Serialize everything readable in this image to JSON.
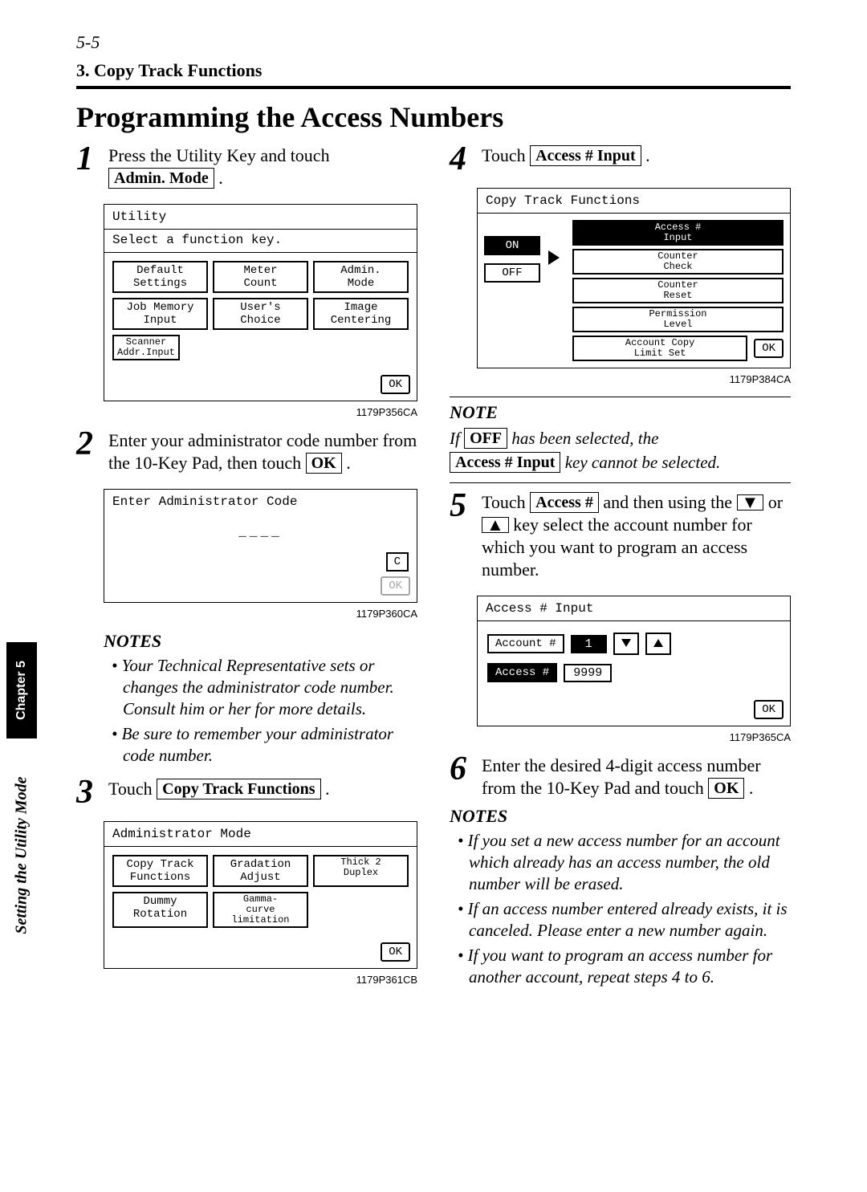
{
  "page_number_label": "5-5",
  "section_header": "3. Copy Track Functions",
  "heading": "Programming the Access Numbers",
  "side_tab_black": "Chapter 5",
  "side_tab_italic": "Setting the Utility Mode",
  "step1": {
    "num": "1",
    "text_before": "Press the Utility Key and touch ",
    "btn": "Admin. Mode",
    "text_after": " ."
  },
  "panel1": {
    "title": "Utility",
    "subtitle": "Select a function key.",
    "buttons_row1": [
      "Default\nSettings",
      "Meter\nCount",
      "Admin.\nMode"
    ],
    "buttons_row2_c0": "Job Memory\nInput",
    "buttons_row2_c1": "User's\nChoice",
    "buttons_row2_c2": "Image\nCentering",
    "buttons_row3": "Scanner\nAddr.Input",
    "ok": "OK",
    "caption": "1179P356CA"
  },
  "step2": {
    "num": "2",
    "text": "Enter your administrator code number from the 10-Key Pad, then touch ",
    "btn": "OK",
    "after": " ."
  },
  "panel2": {
    "title": "Enter Administrator Code",
    "dashes": "____",
    "clear": "C",
    "ok": "OK",
    "caption": "1179P360CA"
  },
  "notes_left": {
    "heading": "NOTES",
    "items": [
      "Your Technical Representative sets or changes the administrator code number. Consult him or her for more details.",
      "Be sure to remember your administrator code number."
    ]
  },
  "step3": {
    "num": "3",
    "text": "Touch ",
    "btn": "Copy Track Functions",
    "after": " ."
  },
  "panel3": {
    "title": "Administrator Mode",
    "r1": [
      "Copy Track\nFunctions",
      "Gradation\nAdjust",
      "Thick 2\nDuplex"
    ],
    "r2": [
      "Dummy\nRotation",
      "Gamma-\ncurve\nlimitation"
    ],
    "ok": "OK",
    "caption": "1179P361CB"
  },
  "step4": {
    "num": "4",
    "text": "Touch ",
    "btn": "Access # Input",
    "after": " ."
  },
  "panel4": {
    "title": "Copy Track Functions",
    "on": "ON",
    "off": "OFF",
    "menu": [
      "Access #\nInput",
      "Counter\nCheck",
      "Counter\nReset",
      "Permission\nLevel",
      "Account Copy\nLimit Set"
    ],
    "ok": "OK",
    "caption": "1179P384CA"
  },
  "note4": {
    "heading": "NOTE",
    "prefix_it": "If ",
    "off_btn": "OFF",
    "mid_it": " has been selected, the ",
    "btn2": "Access # Input",
    "suffix_it": " key cannot be selected."
  },
  "step5": {
    "num": "5",
    "t1": "Touch ",
    "btn": "Access #",
    "t2": " and then using the ",
    "t3": " or ",
    "t4": " key select the account number for which you want to program an access number."
  },
  "panel5": {
    "title": "Access # Input",
    "label_account": "Account #",
    "val_account": "1",
    "label_access": "Access #",
    "val_access": "9999",
    "ok": "OK",
    "caption": "1179P365CA"
  },
  "step6": {
    "num": "6",
    "text": "Enter the desired 4-digit access number from the 10-Key Pad and touch ",
    "btn": "OK",
    "after": " ."
  },
  "notes_right": {
    "heading": "NOTES",
    "items": [
      "If you set a new access number for an account which already has an access number, the old number will be erased.",
      "If an access number entered already exists, it is canceled. Please enter a new number again.",
      "If you want to program an access number for another account, repeat steps 4 to 6."
    ]
  }
}
